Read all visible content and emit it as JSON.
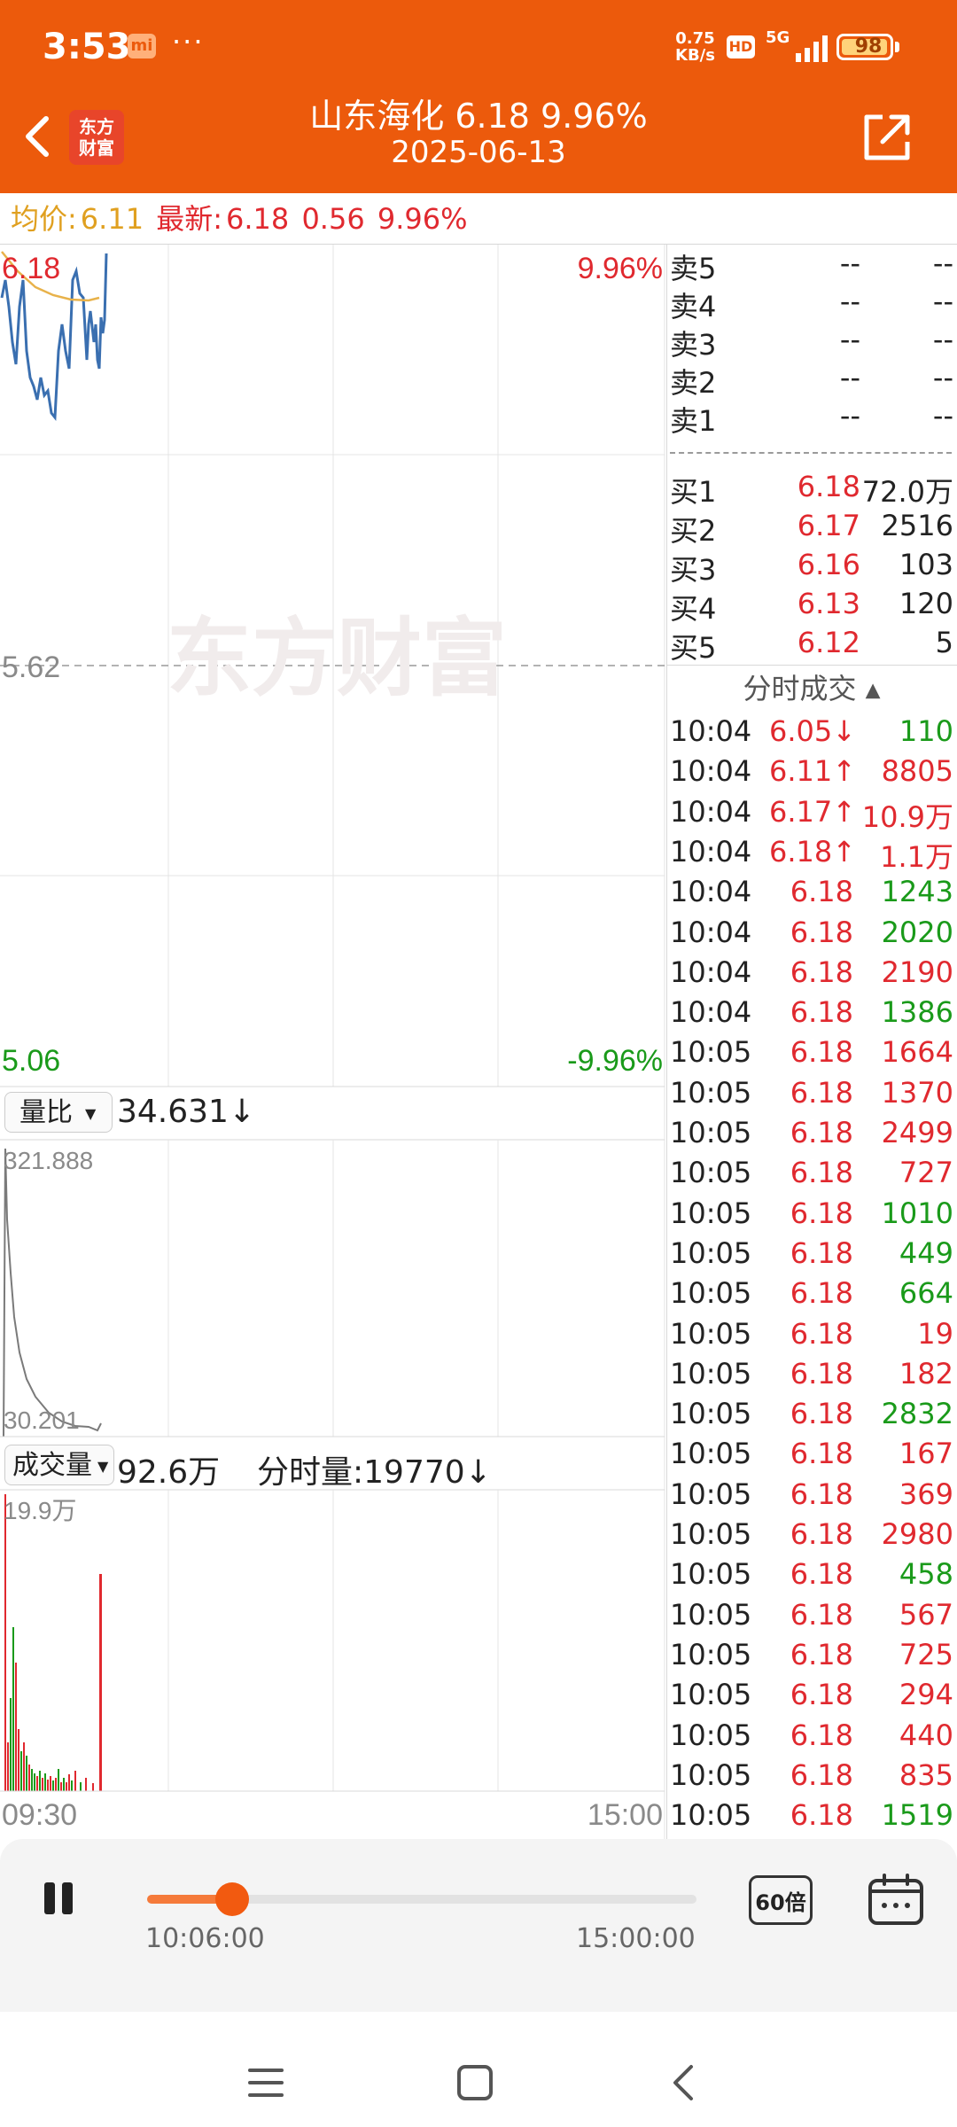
{
  "status_bar": {
    "time": "3:53",
    "mi_badge": "mi",
    "dots": "···",
    "net_speed_value": "0.75",
    "net_speed_unit": "KB/s",
    "hd": "HD",
    "network": "5G",
    "battery": "98"
  },
  "header": {
    "title": "山东海化  6.18  9.96%",
    "date": "2025-06-13",
    "logo_top": "东方",
    "logo_bottom": "财富",
    "back_icon": "chevron-left-icon",
    "share_icon": "share-external-icon"
  },
  "info_line": {
    "avg_label": "均价:",
    "avg_value": "6.11",
    "latest_label": "最新:",
    "latest_value": "6.18",
    "change": "0.56",
    "pct": "9.96%"
  },
  "price_chart": {
    "top_price": "6.18",
    "top_pct": "9.96%",
    "mid_price": "5.62",
    "bottom_price": "5.06",
    "bottom_pct": "-9.96%",
    "watermark": "东方财富",
    "x_start": "09:30",
    "x_end": "15:00"
  },
  "volume_ratio": {
    "dropdown_label": "量比",
    "value": "34.631↓",
    "top_label": "321.888",
    "bottom_label": "30.201"
  },
  "volume_panel": {
    "dropdown_label": "成交量",
    "value": "92.6万",
    "interval_label": "分时量:19770↓",
    "top_label": "19.9万"
  },
  "order_book": {
    "asks": [
      {
        "label": "卖5",
        "price": "--",
        "vol": "--"
      },
      {
        "label": "卖4",
        "price": "--",
        "vol": "--"
      },
      {
        "label": "卖3",
        "price": "--",
        "vol": "--"
      },
      {
        "label": "卖2",
        "price": "--",
        "vol": "--"
      },
      {
        "label": "卖1",
        "price": "--",
        "vol": "--"
      }
    ],
    "bids": [
      {
        "label": "买1",
        "price": "6.18",
        "vol": "72.0万"
      },
      {
        "label": "买2",
        "price": "6.17",
        "vol": "2516"
      },
      {
        "label": "买3",
        "price": "6.16",
        "vol": "103"
      },
      {
        "label": "买4",
        "price": "6.13",
        "vol": "120"
      },
      {
        "label": "买5",
        "price": "6.12",
        "vol": "5"
      }
    ]
  },
  "trades": {
    "header": "分时成交",
    "rows": [
      {
        "time": "10:04",
        "price": "6.05↓",
        "vol": "110",
        "pc": "red",
        "vc": "green"
      },
      {
        "time": "10:04",
        "price": "6.11↑",
        "vol": "8805",
        "pc": "red",
        "vc": "red"
      },
      {
        "time": "10:04",
        "price": "6.17↑",
        "vol": "10.9万",
        "pc": "red",
        "vc": "red"
      },
      {
        "time": "10:04",
        "price": "6.18↑",
        "vol": "1.1万",
        "pc": "red",
        "vc": "red"
      },
      {
        "time": "10:04",
        "price": "6.18",
        "vol": "1243",
        "pc": "red",
        "vc": "green"
      },
      {
        "time": "10:04",
        "price": "6.18",
        "vol": "2020",
        "pc": "red",
        "vc": "green"
      },
      {
        "time": "10:04",
        "price": "6.18",
        "vol": "2190",
        "pc": "red",
        "vc": "red"
      },
      {
        "time": "10:04",
        "price": "6.18",
        "vol": "1386",
        "pc": "red",
        "vc": "green"
      },
      {
        "time": "10:05",
        "price": "6.18",
        "vol": "1664",
        "pc": "red",
        "vc": "red"
      },
      {
        "time": "10:05",
        "price": "6.18",
        "vol": "1370",
        "pc": "red",
        "vc": "red"
      },
      {
        "time": "10:05",
        "price": "6.18",
        "vol": "2499",
        "pc": "red",
        "vc": "red"
      },
      {
        "time": "10:05",
        "price": "6.18",
        "vol": "727",
        "pc": "red",
        "vc": "red"
      },
      {
        "time": "10:05",
        "price": "6.18",
        "vol": "1010",
        "pc": "red",
        "vc": "green"
      },
      {
        "time": "10:05",
        "price": "6.18",
        "vol": "449",
        "pc": "red",
        "vc": "green"
      },
      {
        "time": "10:05",
        "price": "6.18",
        "vol": "664",
        "pc": "red",
        "vc": "green"
      },
      {
        "time": "10:05",
        "price": "6.18",
        "vol": "19",
        "pc": "red",
        "vc": "red"
      },
      {
        "time": "10:05",
        "price": "6.18",
        "vol": "182",
        "pc": "red",
        "vc": "red"
      },
      {
        "time": "10:05",
        "price": "6.18",
        "vol": "2832",
        "pc": "red",
        "vc": "green"
      },
      {
        "time": "10:05",
        "price": "6.18",
        "vol": "167",
        "pc": "red",
        "vc": "red"
      },
      {
        "time": "10:05",
        "price": "6.18",
        "vol": "369",
        "pc": "red",
        "vc": "red"
      },
      {
        "time": "10:05",
        "price": "6.18",
        "vol": "2980",
        "pc": "red",
        "vc": "red"
      },
      {
        "time": "10:05",
        "price": "6.18",
        "vol": "458",
        "pc": "red",
        "vc": "green"
      },
      {
        "time": "10:05",
        "price": "6.18",
        "vol": "567",
        "pc": "red",
        "vc": "red"
      },
      {
        "time": "10:05",
        "price": "6.18",
        "vol": "725",
        "pc": "red",
        "vc": "red"
      },
      {
        "time": "10:05",
        "price": "6.18",
        "vol": "294",
        "pc": "red",
        "vc": "red"
      },
      {
        "time": "10:05",
        "price": "6.18",
        "vol": "440",
        "pc": "red",
        "vc": "red"
      },
      {
        "time": "10:05",
        "price": "6.18",
        "vol": "835",
        "pc": "red",
        "vc": "red"
      },
      {
        "time": "10:05",
        "price": "6.18",
        "vol": "1519",
        "pc": "red",
        "vc": "green"
      }
    ]
  },
  "player": {
    "current_time": "10:06:00",
    "end_time": "15:00:00",
    "speed": "60倍",
    "progress": 0.155
  },
  "colors": {
    "brand": "#ec5a0c",
    "up": "#e0292f",
    "down": "#1a9a1a",
    "avg_line": "#e8b24a",
    "price_line": "#3a6fb0"
  }
}
